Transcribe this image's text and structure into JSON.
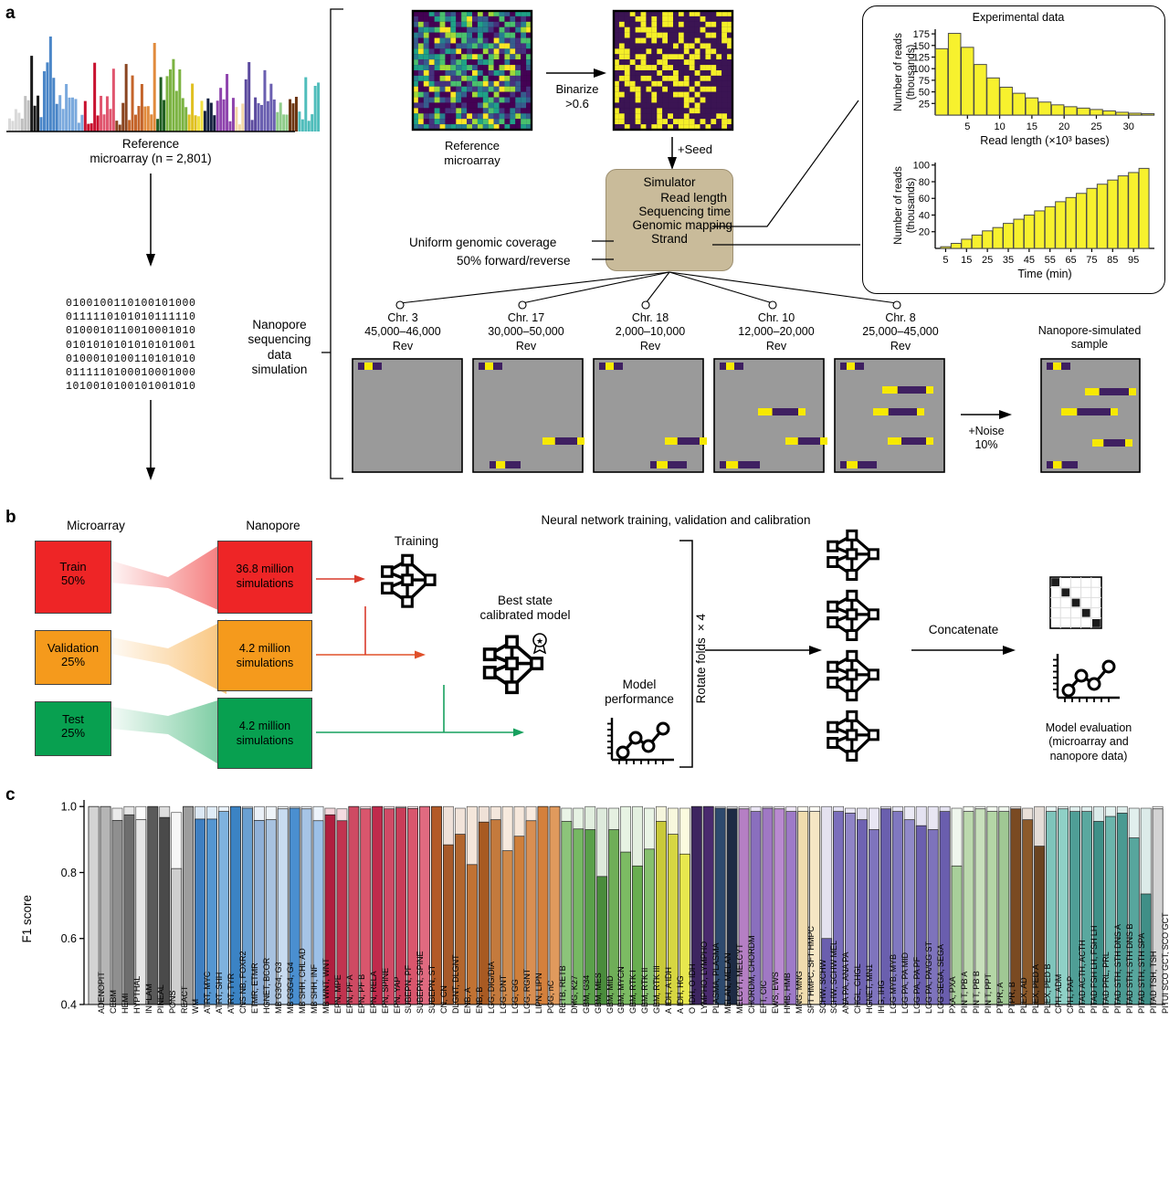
{
  "panels": {
    "a": "a",
    "b": "b",
    "c": "c"
  },
  "panel_a": {
    "reference_microarray_caption_line1": "Reference",
    "reference_microarray_caption_line2": "microarray (n = 2,801)",
    "binary_sequence_lines": [
      "0100100110100101000",
      "0111110101010111110",
      "0100010110010001010",
      "0101010101010101001",
      "0100010100110101010",
      "0111110100010001000",
      "1010010100101001010"
    ],
    "nanopore_sim_label": "Nanopore\nsequencing\ndata\nsimulation",
    "nanopore_sim_lines": [
      "Nanopore",
      "sequencing",
      "data",
      "simulation"
    ],
    "heatmap_caption_lines": [
      "Reference",
      "microarray"
    ],
    "binarize_lines": [
      "Binarize",
      ">0.6"
    ],
    "seed_label": "+Seed",
    "simulator": {
      "title": "Simulator",
      "rows": [
        "Read length",
        "Sequencing time",
        "Genomic mapping",
        "Strand"
      ]
    },
    "simulator_annotations": [
      "Uniform genomic coverage",
      "50% forward/reverse"
    ],
    "experimental_title": "Experimental data",
    "chromosomes": [
      {
        "name": "Chr. 3",
        "range": "45,000–46,000",
        "strand": "Rev"
      },
      {
        "name": "Chr. 17",
        "range": "30,000–50,000",
        "strand": "Rev"
      },
      {
        "name": "Chr. 18",
        "range": "2,000–10,000",
        "strand": "Rev"
      },
      {
        "name": "Chr. 10",
        "range": "12,000–20,000",
        "strand": "Rev"
      },
      {
        "name": "Chr. 8",
        "range": "25,000–45,000",
        "strand": "Rev"
      }
    ],
    "noise_lines": [
      "+Noise",
      "10%"
    ],
    "simulated_sample_lines": [
      "Nanopore-simulated",
      "sample"
    ],
    "colors": {
      "simulator_box": "#c9bb9a",
      "heatmap_yellow": "#f5ef28",
      "heatmap_purple": "#3b1453",
      "read_track_bg": "#9a9a9a",
      "read_yellow": "#f7e900",
      "read_purple": "#3f2061"
    }
  },
  "chart_data": [
    {
      "id": "read-length-histogram",
      "type": "bar",
      "title": "Experimental data",
      "xlabel": "Read length (×10³ bases)",
      "ylabel": "Number of reads\n(thousands)",
      "ylabel_lines": [
        "Number of reads",
        "(thousands)"
      ],
      "yticks": [
        25,
        50,
        75,
        100,
        125,
        150,
        175
      ],
      "ylim": [
        0,
        185
      ],
      "xticks": [
        5,
        10,
        15,
        20,
        25,
        30
      ],
      "xlim": [
        0,
        34
      ],
      "bar_color": "#f7f12e",
      "x": [
        1,
        3,
        5,
        7,
        9,
        11,
        13,
        15,
        17,
        19,
        21,
        23,
        25,
        27,
        29,
        31,
        33
      ],
      "values": [
        143,
        176,
        146,
        109,
        80,
        60,
        47,
        37,
        28,
        22,
        18,
        15,
        12,
        9,
        6,
        4,
        3
      ]
    },
    {
      "id": "sequencing-time-histogram",
      "type": "bar",
      "title": "",
      "xlabel": "Time (min)",
      "ylabel_lines": [
        "Number of reads",
        "(thousands)"
      ],
      "yticks": [
        20,
        40,
        60,
        80,
        100
      ],
      "ylim": [
        0,
        103
      ],
      "xticks": [
        5,
        15,
        25,
        35,
        45,
        55,
        65,
        75,
        85,
        95
      ],
      "xlim": [
        0,
        105
      ],
      "bar_color": "#f7f12e",
      "x": [
        5,
        10,
        15,
        20,
        25,
        30,
        35,
        40,
        45,
        50,
        55,
        60,
        65,
        70,
        75,
        80,
        85,
        90,
        95,
        100
      ],
      "values": [
        2,
        6,
        11,
        16,
        21,
        25,
        30,
        35,
        40,
        45,
        50,
        56,
        61,
        66,
        72,
        77,
        82,
        87,
        91,
        96
      ]
    }
  ],
  "panel_b": {
    "col_headers": [
      "Microarray",
      "Nanopore"
    ],
    "title": "Neural network training, validation and calibration",
    "splits": [
      {
        "name": "Train",
        "pct": "50%",
        "sims": "36.8 million\nsimulations",
        "sims_lines": [
          "36.8 million",
          "simulations"
        ],
        "color": "#ee2526"
      },
      {
        "name": "Validation",
        "pct": "25%",
        "sims": "4.2 million\nsimulations",
        "sims_lines": [
          "4.2 million",
          "simulations"
        ],
        "color": "#f59a1c"
      },
      {
        "name": "Test",
        "pct": "25%",
        "sims": "4.2 million\nsimulations",
        "sims_lines": [
          "4.2 million",
          "simulations"
        ],
        "color": "#08a050"
      }
    ],
    "training_label": "Training",
    "best_state_lines": [
      "Best state",
      "calibrated model"
    ],
    "model_performance_lines": [
      "Model",
      "performance"
    ],
    "rotate_folds_label": "Rotate folds ×4",
    "concatenate_label": "Concatenate",
    "model_evaluation_lines": [
      "Model evaluation",
      "(microarray and",
      "nanopore data)"
    ],
    "arrow_colors": {
      "train": "#d83a2b",
      "validation": "#e0502a",
      "test": "#17a05e"
    }
  },
  "panel_c": {
    "ylabel": "F1 score",
    "yticks": [
      "1.0",
      "0.8",
      "0.6",
      "0.4"
    ],
    "ytick_values": [
      1.0,
      0.8,
      0.6,
      0.4
    ],
    "ylim": [
      0.4,
      1.02
    ],
    "chart_data": {
      "type": "bar",
      "title": "",
      "xlabel": "",
      "ylabel": "F1 score",
      "ylim": [
        0.4,
        1.02
      ],
      "yticks": [
        0.4,
        0.6,
        0.8,
        1.0
      ],
      "series": [
        {
          "name": "nanopore-background",
          "note": "light translucent bar behind"
        },
        {
          "name": "microarray-foreground",
          "note": "solid saturated bar in front"
        }
      ],
      "categories": [
        "ADENOPIT",
        "CEBM",
        "HEMI",
        "HYPTHAL",
        "INFLAM",
        "PINEAL",
        "PONS",
        "REACT",
        "WM",
        "ATRT, MYC",
        "ATRT, SHH",
        "ATRT, TYR",
        "CNS NB, FOXR2",
        "ETMR, ETMR",
        "HGNET, BCOR",
        "MB G3G4, G3",
        "MB G3G4, G4",
        "MB SHH, CHL AD",
        "MB SHH, INF",
        "MB WNT, WNT",
        "EPN, MPE",
        "EPN, PF A",
        "EPN, PF B",
        "EPN, RELA",
        "EPN, SPINE",
        "EPN, YAP",
        "SUBEPN, PF",
        "SUBEPN, SPINE",
        "SUBEPN, ST",
        "CN, CN",
        "DLGNT, DLGNT",
        "ENB, A",
        "ENB, B",
        "LGG, DIG/DIA",
        "LGG, DNT",
        "LGG, GG",
        "LGG, RGNT",
        "LIPN, LIPN",
        "PGG, nC",
        "RETB, RETB",
        "DMG, K27",
        "GBM, G34",
        "GBM, MES",
        "GBM, MID",
        "GBM, MYCN",
        "GBM, RTK I",
        "GBM, RTK II",
        "GBM, RTK III",
        "A IDH, A IDH",
        "A IDH, HG",
        "O IDH, O IDH",
        "LYMPHO, LYMPHO",
        "PLASMA, PLASMA",
        "MELAN, MELAN",
        "MELCYT, MELCYT",
        "CHORDM, CHORDM",
        "EFT, CIC",
        "EWS, EWS",
        "HMB, HMB",
        "MNG, MNG",
        "SFT HMPC, SFT HMPC",
        "SCHW, SCHW",
        "SCHW, SCHW MEL",
        "ANA PA, ANA PA",
        "CHGL, CHGL",
        "HGNET, MN1",
        "IHG, IHG",
        "LGG MYB, MYB",
        "LGG PA, PA MID",
        "LGG PA, PA PF",
        "LGG PA, PA/GG ST",
        "LGG SEGA, SEGA",
        "PXA, PXA",
        "PIN T, PB A",
        "PIN T, PB B",
        "PIN T, PPT",
        "PTPR, A",
        "PTPR, B",
        "PLEX, AD",
        "PLEX, PED A",
        "PLEX, PED B",
        "CPH, ADM",
        "CPH, PAP",
        "PITAD ACTH, ACTH",
        "PITAD FSH LH, FSH LH",
        "PITAD PRL, PRL",
        "PITAD STH, STH DNS A",
        "PITAD STH, STH DNS B",
        "PITAD STH, STH SPA",
        "PITAD TSH, TSH",
        "PITUI SCO GCT, SCO GCT"
      ],
      "microarray_values": [
        1.0,
        1.0,
        0.958,
        0.975,
        0.96,
        1.0,
        0.967,
        0.812,
        1.0,
        0.962,
        0.962,
        0.985,
        1.0,
        0.995,
        0.958,
        0.96,
        0.993,
        0.995,
        0.993,
        0.957,
        0.975,
        0.957,
        1.0,
        0.993,
        1.0,
        0.993,
        0.996,
        0.994,
        1.0,
        1.0,
        0.884,
        0.916,
        0.824,
        0.953,
        0.96,
        0.866,
        0.91,
        0.957,
        1.0,
        1.0,
        0.955,
        0.932,
        0.93,
        0.788,
        0.93,
        0.862,
        0.82,
        0.871,
        0.955,
        0.916,
        0.856,
        1.0,
        1.0,
        0.995,
        0.993,
        0.993,
        0.985,
        0.995,
        0.993,
        0.985,
        0.985,
        0.985,
        0.6,
        0.985,
        0.98,
        0.96,
        0.93,
        0.993,
        0.985,
        0.96,
        0.942,
        0.93,
        0.985,
        0.82,
        0.985,
        0.993,
        0.985,
        0.985,
        0.993,
        0.96,
        0.88,
        0.985,
        0.993,
        0.985,
        0.985,
        0.955,
        0.97,
        0.98,
        0.905,
        0.735,
        0.993
      ],
      "nanopore_values": [
        1.0,
        1.0,
        0.995,
        1.0,
        1.0,
        1.0,
        1.0,
        0.982,
        1.0,
        1.0,
        1.0,
        1.0,
        1.0,
        1.0,
        1.0,
        1.0,
        1.0,
        1.0,
        1.0,
        1.0,
        0.995,
        0.993,
        1.0,
        1.0,
        1.0,
        1.0,
        1.0,
        1.0,
        1.0,
        1.0,
        1.0,
        0.995,
        1.0,
        1.0,
        1.0,
        1.0,
        1.0,
        1.0,
        1.0,
        1.0,
        0.995,
        0.995,
        1.0,
        0.995,
        0.995,
        1.0,
        1.0,
        0.995,
        1.0,
        0.995,
        0.995,
        1.0,
        1.0,
        1.0,
        1.0,
        1.0,
        1.0,
        1.0,
        1.0,
        1.0,
        1.0,
        1.0,
        1.0,
        1.0,
        0.995,
        0.995,
        0.995,
        1.0,
        1.0,
        1.0,
        1.0,
        1.0,
        1.0,
        0.995,
        1.0,
        1.0,
        1.0,
        1.0,
        1.0,
        0.995,
        1.0,
        1.0,
        1.0,
        1.0,
        1.0,
        1.0,
        1.0,
        1.0,
        0.995,
        0.995,
        1.0
      ],
      "colors": [
        "#d3d3d3",
        "#b5b5b5",
        "#8f8f8f",
        "#6e6e6e",
        "#e6e6e6",
        "#5a5a5a",
        "#4a4a4a",
        "#cfcfcf",
        "#9d9d9d",
        "#3f7fc1",
        "#5596d1",
        "#7fb2de",
        "#3b83c4",
        "#6aa0d2",
        "#8fb0d8",
        "#a8c2e0",
        "#c8dbf0",
        "#4a8fd0",
        "#a6c4e6",
        "#9cc0e8",
        "#b01f3f",
        "#c13450",
        "#ce4a63",
        "#d9566d",
        "#c02a4c",
        "#d04a66",
        "#c83d59",
        "#d9566d",
        "#e06a80",
        "#b35a28",
        "#a85a2a",
        "#b2662e",
        "#c17233",
        "#a85a22",
        "#c47a3d",
        "#d18a4a",
        "#cf7f3a",
        "#d98f52",
        "#d4803c",
        "#e09a5d",
        "#8cc47a",
        "#76b863",
        "#5aa04a",
        "#4a8c3c",
        "#6fae58",
        "#7cbb63",
        "#68ae50",
        "#86c06e",
        "#c9c93a",
        "#d6d642",
        "#e8e84e",
        "#3d2560",
        "#4a2a6e",
        "#2e4a6e",
        "#1e2b44",
        "#b57fc4",
        "#8a6fbe",
        "#a078c4",
        "#b98ad0",
        "#9e7ac8",
        "#f0dcae",
        "#f5e6c4",
        "#6a5fae",
        "#7a6ebb",
        "#8f84c6",
        "#6f63b2",
        "#7f74bd",
        "#6a5fae",
        "#8078c0",
        "#9089c9",
        "#6b5faf",
        "#7e73bc",
        "#6a5eae",
        "#a8cf9a",
        "#bcd9ae",
        "#c8e0bc",
        "#b4d6a6",
        "#a0c894",
        "#7a4a22",
        "#8c5a2a",
        "#6b4420",
        "#7fc4bb",
        "#8fd0c6",
        "#4f9e96",
        "#5aa89f",
        "#3f9088",
        "#6bb5ac",
        "#4a9a92",
        "#57a69d",
        "#3f8f87"
      ]
    }
  }
}
